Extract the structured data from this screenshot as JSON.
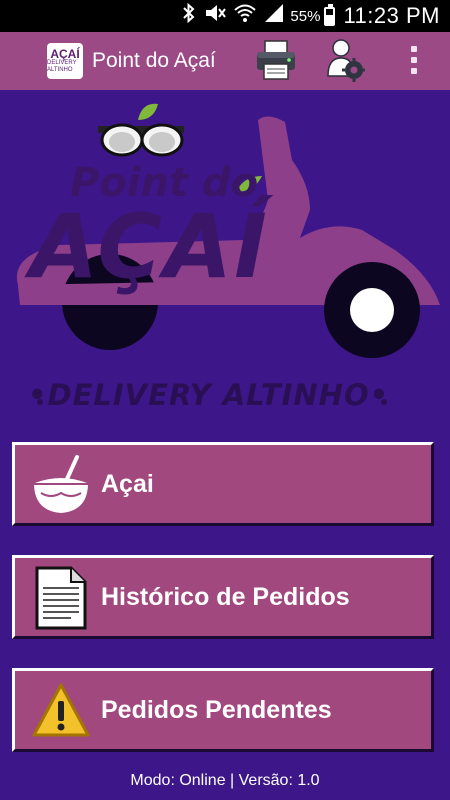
{
  "status_bar": {
    "battery_percent": "55%",
    "battery_level": 0.55,
    "time": "11:23 PM"
  },
  "app_bar": {
    "logo_top": "AÇAÍ",
    "logo_bottom": "DELIVERY ALTINHO",
    "title": "Point do Açaí"
  },
  "brand": {
    "line1": "Point do",
    "line2": "AÇAÍ",
    "line3": "•DELIVERY ALTINHO•"
  },
  "menu": [
    {
      "label": "Açai",
      "icon": "acai-bowl-icon"
    },
    {
      "label": "Histórico de Pedidos",
      "icon": "document-icon"
    },
    {
      "label": "Pedidos Pendentes",
      "icon": "warning-icon"
    }
  ],
  "footer": {
    "text": "Modo: Online | Versão: 1.0"
  },
  "colors": {
    "background": "#3d1689",
    "app_bar": "#9c4a86",
    "button": "#a1487f",
    "scooter": "#8d3f8a"
  }
}
